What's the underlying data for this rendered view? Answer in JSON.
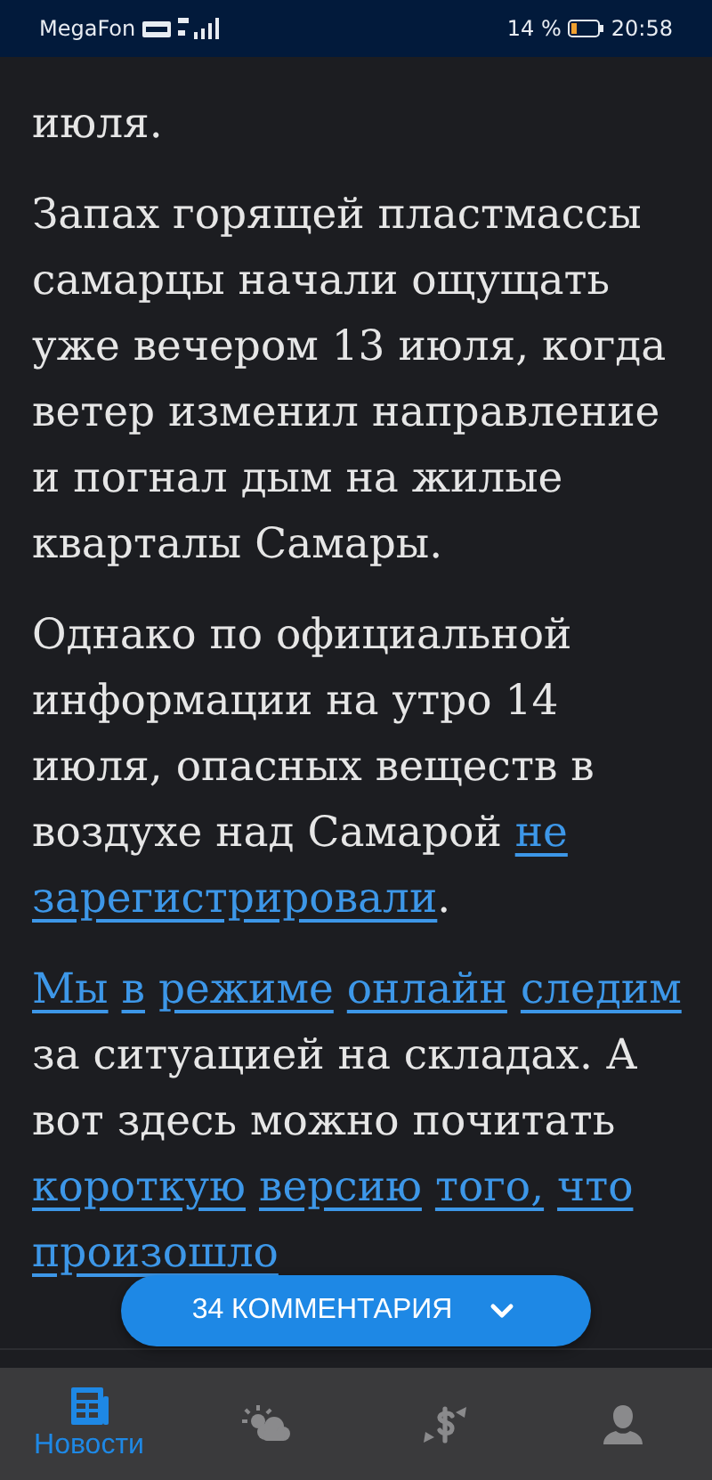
{
  "status_bar": {
    "carrier": "MegaFon",
    "battery": "14 %",
    "time": "20:58"
  },
  "article": {
    "paragraphs": [
      [
        {
          "text": "июля.",
          "link": false
        }
      ],
      [
        {
          "text": "Запах горящей пластмассы самарцы начали ощущать уже вечером 13 июля, когда ветер изменил направление и погнал дым на жилые кварталы Самары.",
          "link": false
        }
      ],
      [
        {
          "text": "Однако по официальной информации на утро 14 июля, опасных веществ в воздухе над Самарой ",
          "link": false
        },
        {
          "text": "не зарегистрировали",
          "link": true
        },
        {
          "text": ".",
          "link": false
        }
      ],
      [
        {
          "text": "Мы в режиме онлайн следим",
          "link": true
        },
        {
          "text": " за ситуацией на складах. А вот здесь можно почитать ",
          "link": false
        },
        {
          "text": "короткую версию того, что произошло",
          "link": true
        }
      ]
    ]
  },
  "comments_button": {
    "label": "34 КОММЕНТАРИЯ"
  },
  "nav": {
    "tabs": [
      {
        "kind": "news",
        "label": "Новости",
        "selected": true
      },
      {
        "kind": "weather",
        "selected": false
      },
      {
        "kind": "currency",
        "selected": false
      },
      {
        "kind": "profile",
        "selected": false
      }
    ]
  }
}
